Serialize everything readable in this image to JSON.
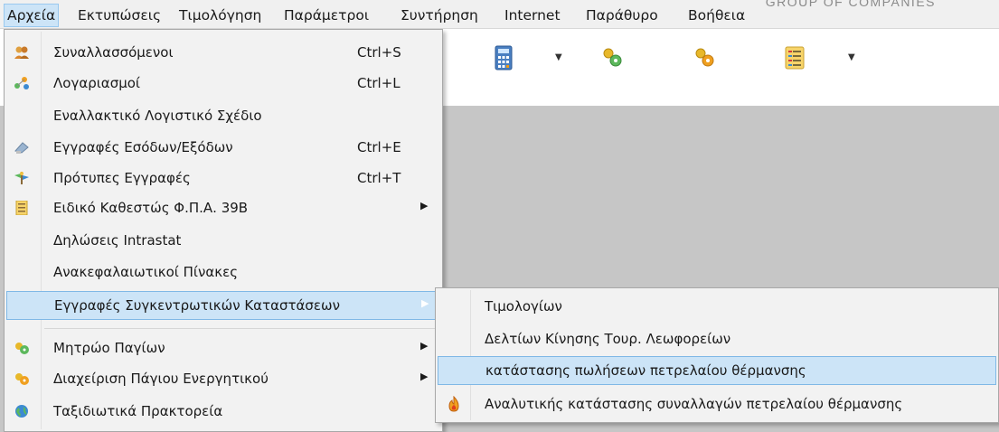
{
  "menubar": {
    "items": [
      "Αρχεία",
      "Εκτυπώσεις",
      "Τιμολόγηση",
      "Παράμετροι",
      "Συντήρηση",
      "Internet",
      "Παράθυρο",
      "Βοήθεια"
    ],
    "active_index": 0
  },
  "watermark": "GROUP OF COMPANIES",
  "toolbar": {
    "buttons": [
      "calculator-icon",
      "gears-green-icon",
      "gears-yellow-icon",
      "report-icon"
    ]
  },
  "file_menu": {
    "items": [
      {
        "label": "Συναλλασσόμενοι",
        "shortcut": "Ctrl+S",
        "icon": "people-icon"
      },
      {
        "label": "Λογαριασμοί",
        "shortcut": "Ctrl+L",
        "icon": "accounts-icon"
      },
      {
        "label": "Εναλλακτικό Λογιστικό Σχέδιο",
        "shortcut": "",
        "icon": ""
      },
      {
        "label": "Εγγραφές Εσόδων/Εξόδων",
        "shortcut": "Ctrl+E",
        "icon": "entries-icon"
      },
      {
        "label": "Πρότυπες Εγγραφές",
        "shortcut": "Ctrl+T",
        "icon": "template-icon"
      },
      {
        "label": "Ειδικό Καθεστώς Φ.Π.Α. 39Β",
        "shortcut": "",
        "icon": "document-icon",
        "submenu": true
      },
      {
        "label": "Δηλώσεις Intrastat",
        "shortcut": "",
        "icon": ""
      },
      {
        "label": "Ανακεφαλαιωτικοί Πίνακες",
        "shortcut": "",
        "icon": ""
      },
      {
        "label": "Εγγραφές Συγκεντρωτικών Καταστάσεων",
        "shortcut": "",
        "icon": "",
        "submenu": true,
        "highlighted": true
      },
      {
        "label": "Μητρώο Παγίων",
        "shortcut": "",
        "icon": "gears-green-icon",
        "submenu": true
      },
      {
        "label": "Διαχείριση Πάγιου Ενεργητικού",
        "shortcut": "",
        "icon": "gears-yellow-icon",
        "submenu": true
      },
      {
        "label": "Ταξιδιωτικά Πρακτορεία",
        "shortcut": "",
        "icon": "globe-icon"
      }
    ]
  },
  "submenu": {
    "items": [
      {
        "label": "Τιμολογίων",
        "icon": ""
      },
      {
        "label": "Δελτίων Κίνησης Τουρ. Λεωφορείων",
        "icon": ""
      },
      {
        "label": "κατάστασης πωλήσεων πετρελαίου θέρμανσης",
        "icon": "",
        "highlighted": true
      },
      {
        "label": "Αναλυτικής κατάστασης συναλλαγών πετρελαίου θέρμανσης",
        "icon": "flame-icon"
      }
    ]
  },
  "colors": {
    "highlight_bg": "#cce4f7",
    "highlight_border": "#7fb8e6",
    "menu_bg": "#f2f2f2",
    "workspace": "#c6c6c6"
  }
}
